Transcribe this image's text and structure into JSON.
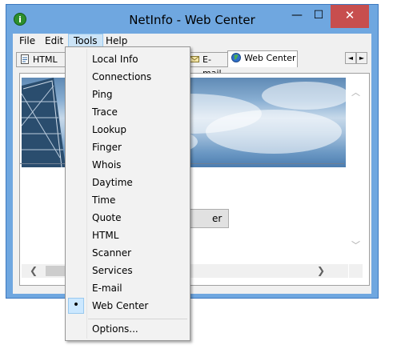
{
  "window": {
    "title": "NetInfo - Web Center",
    "app_icon_glyph": "i",
    "controls": {
      "minimize": "—",
      "maximize": "☐",
      "close": "✕"
    }
  },
  "menubar": {
    "items": [
      {
        "label": "File"
      },
      {
        "label": "Edit"
      },
      {
        "label": "Tools"
      },
      {
        "label": "Help"
      }
    ]
  },
  "tabs": {
    "html": {
      "label": "HTML",
      "icon": "html-page-icon"
    },
    "email": {
      "label": "E-mail",
      "icon": "email-icon"
    },
    "webcenter": {
      "label": "Web Center",
      "icon": "globe-icon",
      "selected": true
    },
    "scroll_left": "◄",
    "scroll_right": "►"
  },
  "content": {
    "button_partial_label": "er",
    "vscroll_up": "︿",
    "vscroll_down": "﹀",
    "hscroll_left": "❮",
    "hscroll_right": "❯"
  },
  "tools_menu": {
    "items": [
      {
        "label": "Local Info"
      },
      {
        "label": "Connections"
      },
      {
        "label": "Ping"
      },
      {
        "label": "Trace"
      },
      {
        "label": "Lookup"
      },
      {
        "label": "Finger"
      },
      {
        "label": "Whois"
      },
      {
        "label": "Daytime"
      },
      {
        "label": "Time"
      },
      {
        "label": "Quote"
      },
      {
        "label": "HTML"
      },
      {
        "label": "Scanner"
      },
      {
        "label": "Services"
      },
      {
        "label": "E-mail"
      },
      {
        "label": "Web Center",
        "checked": true,
        "check_glyph": "•"
      },
      {
        "label": "Options..."
      }
    ]
  },
  "colors": {
    "window_frame": "#6fa7e0",
    "close_button": "#c74e4e",
    "menu_highlight": "#cce4f7"
  }
}
